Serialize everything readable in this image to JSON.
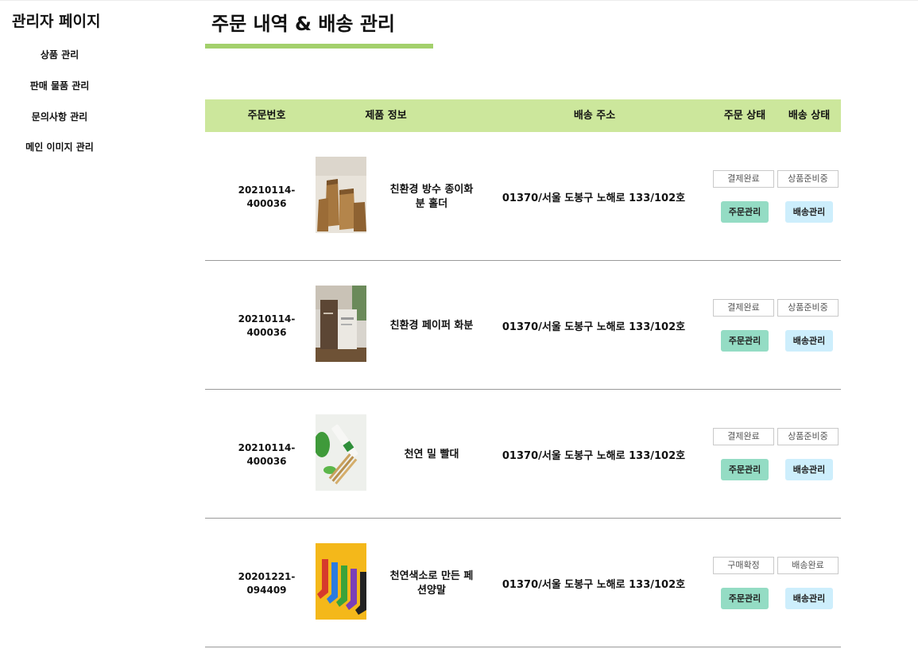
{
  "sidebar": {
    "title": "관리자 페이지",
    "items": [
      {
        "label": "상품 관리"
      },
      {
        "label": "판매 물품 관리"
      },
      {
        "label": "문의사항 관리"
      },
      {
        "label": "메인 이미지 관리"
      }
    ]
  },
  "page": {
    "title": "주문 내역 & 배송 관리"
  },
  "colors": {
    "accent_underline": "#a3d06c",
    "header_bg": "#cce79c",
    "order_manage_btn": "#94dcc4",
    "delivery_manage_btn": "#cdeefc"
  },
  "table": {
    "headers": {
      "order_no": "주문번호",
      "product": "제품 정보",
      "address": "배송 주소",
      "order_status": "주문 상태",
      "delivery_status": "배송 상태"
    },
    "rows": [
      {
        "order_no_1": "20210114-",
        "order_no_2": "400036",
        "product_line1": "친환경 방수 종이화",
        "product_line2": "분 홀더",
        "image": "kraft-paper-pot-holders",
        "address": "01370/서울 도봉구 노해로 133/102호",
        "order_status": "결제완료",
        "delivery_status": "상품준비중",
        "order_btn": "주문관리",
        "delivery_btn": "배송관리"
      },
      {
        "order_no_1": "20210114-",
        "order_no_2": "400036",
        "product_line1": "친환경 페이퍼 화분",
        "product_line2": "",
        "image": "paper-planter-pots",
        "address": "01370/서울 도봉구 노해로 133/102호",
        "order_status": "결제완료",
        "delivery_status": "상품준비중",
        "order_btn": "주문관리",
        "delivery_btn": "배송관리"
      },
      {
        "order_no_1": "20210114-",
        "order_no_2": "400036",
        "product_line1": "천연 밀 빨대",
        "product_line2": "",
        "image": "natural-wheat-straws",
        "address": "01370/서울 도봉구 노해로 133/102호",
        "order_status": "결제완료",
        "delivery_status": "상품준비중",
        "order_btn": "주문관리",
        "delivery_btn": "배송관리"
      },
      {
        "order_no_1": "20201221-",
        "order_no_2": "094409",
        "product_line1": "천연색소로 만든 페",
        "product_line2": "션양말",
        "image": "colorful-socks",
        "address": "01370/서울 도봉구 노해로 133/102호",
        "order_status": "구매확정",
        "delivery_status": "배송완료",
        "order_btn": "주문관리",
        "delivery_btn": "배송관리"
      }
    ]
  }
}
